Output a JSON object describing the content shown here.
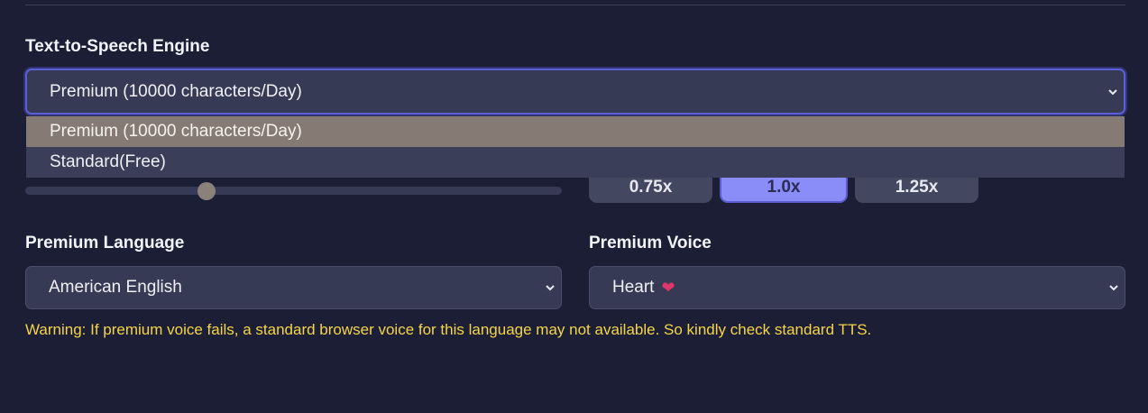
{
  "engine": {
    "label": "Text-to-Speech Engine",
    "selected": "Premium (10000 characters/Day)",
    "options": [
      "Premium (10000 characters/Day)",
      "Standard(Free)"
    ]
  },
  "speed": {
    "buttons": [
      "0.75x",
      "1.0x",
      "1.25x"
    ],
    "active": "1.0x"
  },
  "language": {
    "label": "Premium Language",
    "selected": "American English"
  },
  "voice": {
    "label": "Premium Voice",
    "selected": "Heart",
    "emoji": "❤"
  },
  "warning": "Warning: If premium voice fails, a standard browser voice for this language may not available. So kindly check standard TTS.",
  "colors": {
    "background": "#1b1e35",
    "accent": "#8a8cf7",
    "warning": "#f5d547",
    "selected_option": "#857b74"
  },
  "icons": [
    "chevron-down-icon",
    "heart-icon"
  ]
}
